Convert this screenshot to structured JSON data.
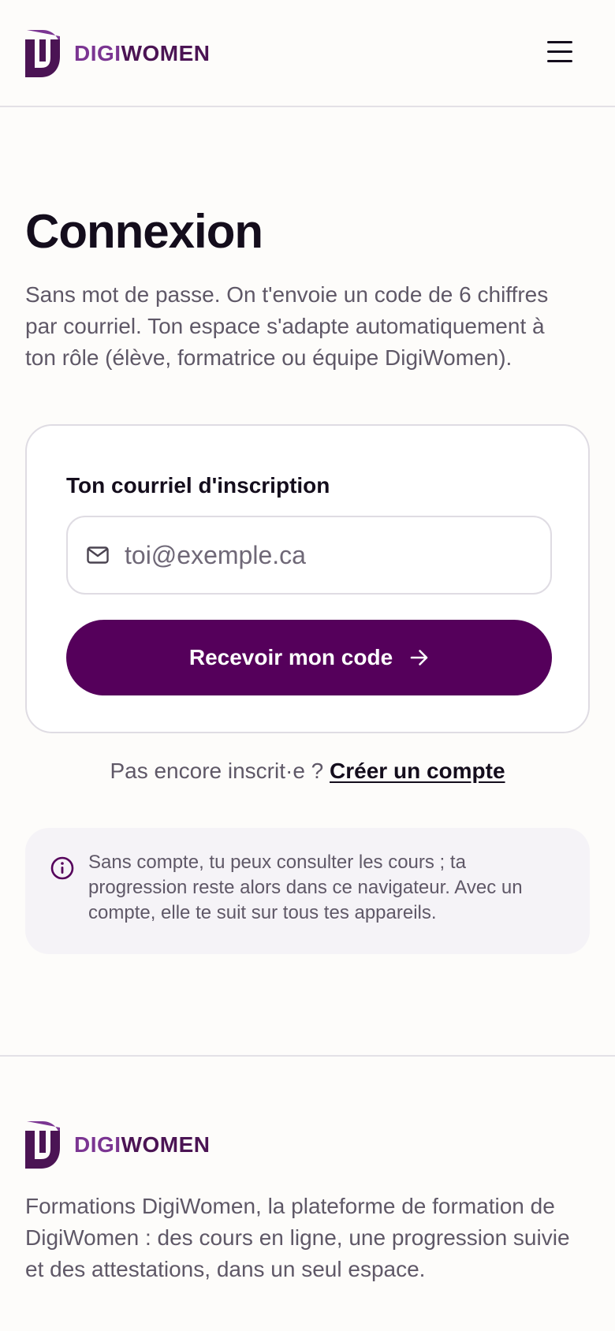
{
  "header": {
    "logo": {
      "digi": "DIGI",
      "women": "WOMEN"
    },
    "menu_icon": "hamburger-menu-icon"
  },
  "main": {
    "title": "Connexion",
    "intro": "Sans mot de passe. On t'envoie un code de 6 chiffres par courriel. Ton espace s'adapte automatiquement à ton rôle (élève, formatrice ou équipe DigiWomen).",
    "form": {
      "label": "Ton courriel d'inscription",
      "email_placeholder": "toi@exemple.ca",
      "email_value": "",
      "email_icon": "mail-icon",
      "submit_label": "Recevoir mon code",
      "submit_icon": "arrow-right-icon"
    },
    "signup": {
      "prompt": "Pas encore inscrit·e ?",
      "link": "Créer un compte"
    },
    "notice": {
      "icon": "info-icon",
      "text": "Sans compte, tu peux consulter les cours ; ta progression reste alors dans ce navigateur. Avec un compte, elle te suit sur tous tes appareils."
    }
  },
  "footer": {
    "logo": {
      "digi": "DIGI",
      "women": "WOMEN"
    },
    "description": "Formations DigiWomen, la plateforme de formation de DigiWomen : des cours en ligne, une progression suivie et des attestations, dans un seul espace."
  },
  "colors": {
    "brand_primary": "#55005b",
    "logo_light": "#7b3592",
    "logo_dark": "#4b1454",
    "background": "#fdfcfa",
    "notice_background": "#f5f3f7"
  }
}
